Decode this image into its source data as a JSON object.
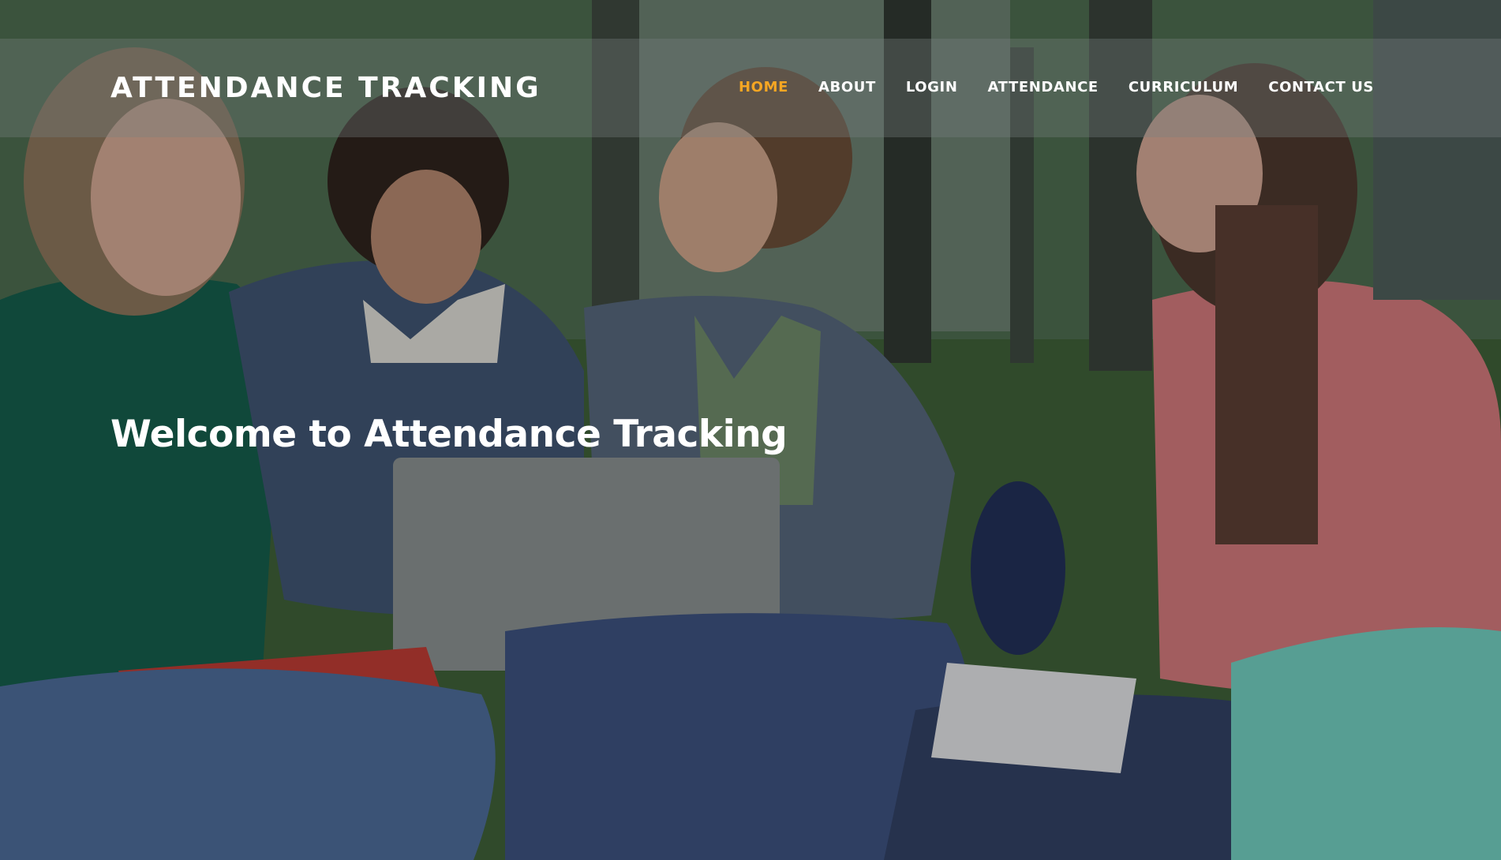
{
  "site": {
    "brand": "ATTENDANCE TRACKING"
  },
  "nav": {
    "items": [
      {
        "label": "HOME",
        "active": true
      },
      {
        "label": "ABOUT",
        "active": false
      },
      {
        "label": "LOGIN",
        "active": false
      },
      {
        "label": "ATTENDANCE",
        "active": false
      },
      {
        "label": "CURRICULUM",
        "active": false
      },
      {
        "label": "CONTACT US",
        "active": false
      }
    ]
  },
  "hero": {
    "headline": "Welcome to Attendance Tracking"
  },
  "colors": {
    "accent": "#f5a623",
    "text": "#ffffff"
  }
}
